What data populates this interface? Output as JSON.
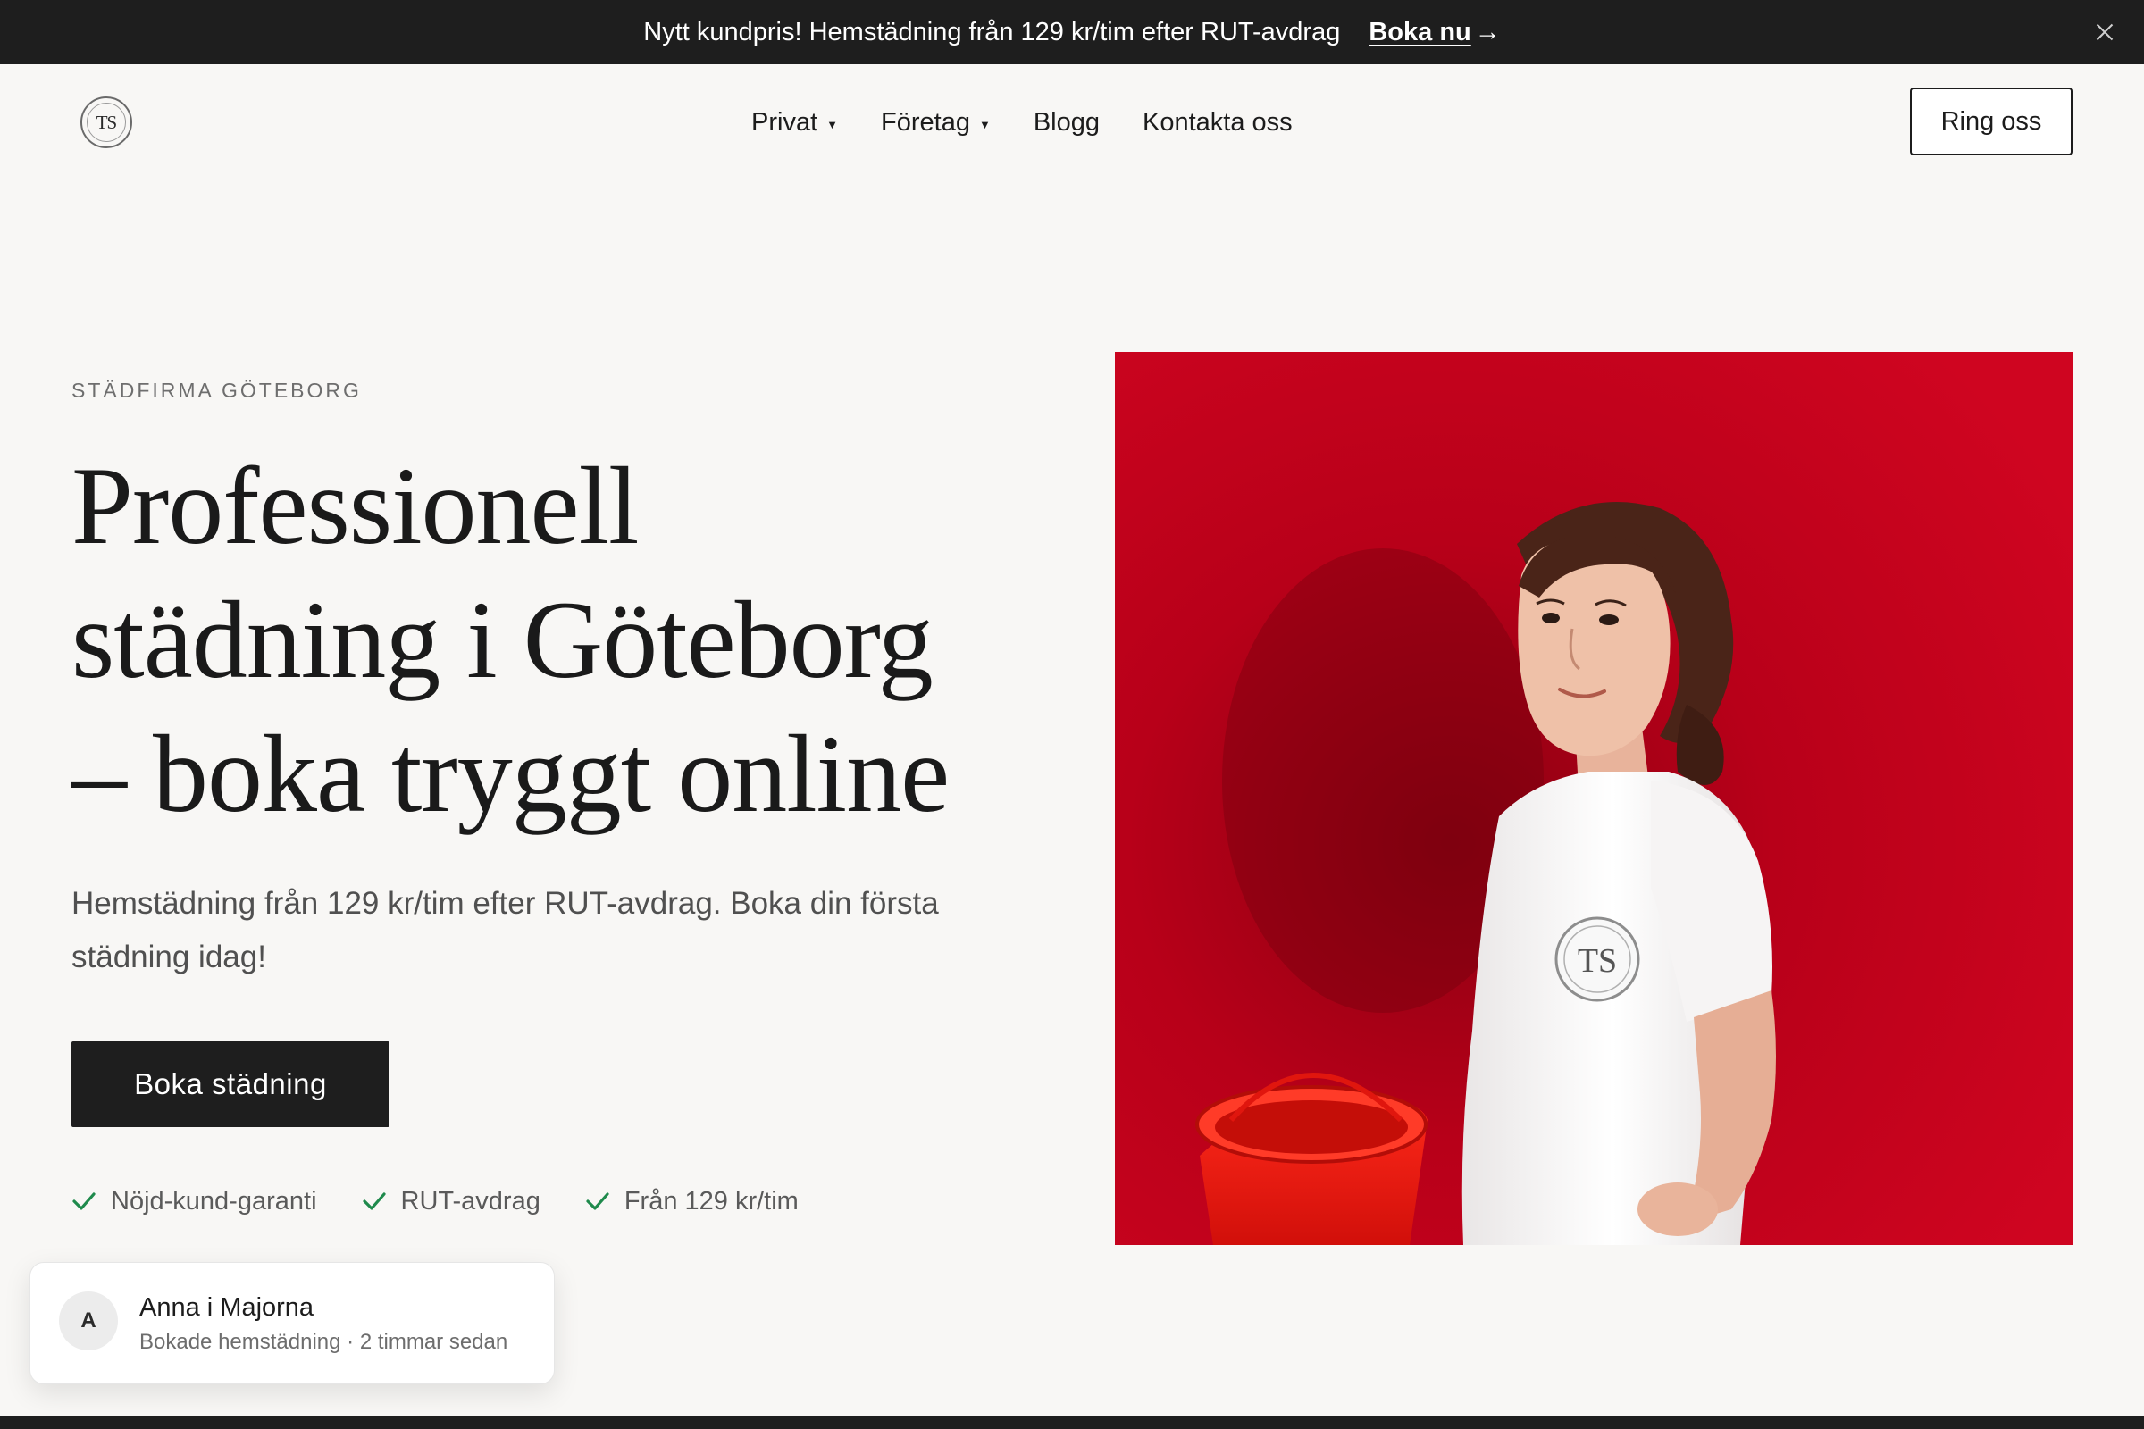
{
  "announcement": {
    "message": "Nytt kundpris! Hemstädning från 129 kr/tim efter RUT-avdrag",
    "cta_label": "Boka nu",
    "cta_icon": "arrow-right-icon",
    "close_icon": "close-icon"
  },
  "header": {
    "logo_text": "TS",
    "nav": [
      {
        "label": "Privat",
        "dropdown": true
      },
      {
        "label": "Företag",
        "dropdown": true
      },
      {
        "label": "Blogg",
        "dropdown": false
      },
      {
        "label": "Kontakta oss",
        "dropdown": false
      }
    ],
    "call_button": "Ring oss"
  },
  "hero": {
    "eyebrow": "STÄDFIRMA GÖTEBORG",
    "headline_lines": [
      "Professionell",
      "städning i Göteborg",
      "– boka tryggt online"
    ],
    "subtitle": "Hemstädning från 129 kr/tim efter RUT-avdrag. Boka din första städning idag!",
    "cta_label": "Boka städning",
    "features": [
      "Nöjd-kund-garanti",
      "RUT-avdrag",
      "Från 129 kr/tim"
    ],
    "photo_logo_text": "TS"
  },
  "toast": {
    "avatar_letter": "A",
    "name": "Anna i Majorna",
    "detail": "Bokade hemstädning · 2 timmar sedan"
  },
  "colors": {
    "background": "#f8f7f5",
    "dark": "#1e1e1e",
    "check_green": "#1f8a4c",
    "photo_red": "#c8001c"
  }
}
